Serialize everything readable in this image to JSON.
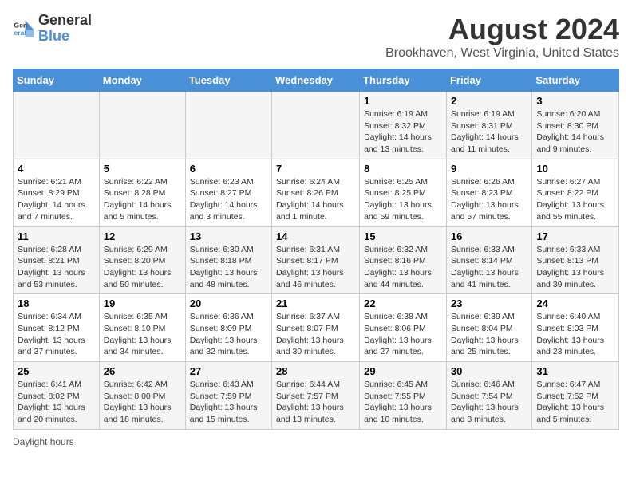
{
  "header": {
    "logo_line1": "General",
    "logo_line2": "Blue",
    "main_title": "August 2024",
    "subtitle": "Brookhaven, West Virginia, United States"
  },
  "days_of_week": [
    "Sunday",
    "Monday",
    "Tuesday",
    "Wednesday",
    "Thursday",
    "Friday",
    "Saturday"
  ],
  "footer": "Daylight hours",
  "weeks": [
    [
      {
        "num": "",
        "info": ""
      },
      {
        "num": "",
        "info": ""
      },
      {
        "num": "",
        "info": ""
      },
      {
        "num": "",
        "info": ""
      },
      {
        "num": "1",
        "info": "Sunrise: 6:19 AM\nSunset: 8:32 PM\nDaylight: 14 hours and 13 minutes."
      },
      {
        "num": "2",
        "info": "Sunrise: 6:19 AM\nSunset: 8:31 PM\nDaylight: 14 hours and 11 minutes."
      },
      {
        "num": "3",
        "info": "Sunrise: 6:20 AM\nSunset: 8:30 PM\nDaylight: 14 hours and 9 minutes."
      }
    ],
    [
      {
        "num": "4",
        "info": "Sunrise: 6:21 AM\nSunset: 8:29 PM\nDaylight: 14 hours and 7 minutes."
      },
      {
        "num": "5",
        "info": "Sunrise: 6:22 AM\nSunset: 8:28 PM\nDaylight: 14 hours and 5 minutes."
      },
      {
        "num": "6",
        "info": "Sunrise: 6:23 AM\nSunset: 8:27 PM\nDaylight: 14 hours and 3 minutes."
      },
      {
        "num": "7",
        "info": "Sunrise: 6:24 AM\nSunset: 8:26 PM\nDaylight: 14 hours and 1 minute."
      },
      {
        "num": "8",
        "info": "Sunrise: 6:25 AM\nSunset: 8:25 PM\nDaylight: 13 hours and 59 minutes."
      },
      {
        "num": "9",
        "info": "Sunrise: 6:26 AM\nSunset: 8:23 PM\nDaylight: 13 hours and 57 minutes."
      },
      {
        "num": "10",
        "info": "Sunrise: 6:27 AM\nSunset: 8:22 PM\nDaylight: 13 hours and 55 minutes."
      }
    ],
    [
      {
        "num": "11",
        "info": "Sunrise: 6:28 AM\nSunset: 8:21 PM\nDaylight: 13 hours and 53 minutes."
      },
      {
        "num": "12",
        "info": "Sunrise: 6:29 AM\nSunset: 8:20 PM\nDaylight: 13 hours and 50 minutes."
      },
      {
        "num": "13",
        "info": "Sunrise: 6:30 AM\nSunset: 8:18 PM\nDaylight: 13 hours and 48 minutes."
      },
      {
        "num": "14",
        "info": "Sunrise: 6:31 AM\nSunset: 8:17 PM\nDaylight: 13 hours and 46 minutes."
      },
      {
        "num": "15",
        "info": "Sunrise: 6:32 AM\nSunset: 8:16 PM\nDaylight: 13 hours and 44 minutes."
      },
      {
        "num": "16",
        "info": "Sunrise: 6:33 AM\nSunset: 8:14 PM\nDaylight: 13 hours and 41 minutes."
      },
      {
        "num": "17",
        "info": "Sunrise: 6:33 AM\nSunset: 8:13 PM\nDaylight: 13 hours and 39 minutes."
      }
    ],
    [
      {
        "num": "18",
        "info": "Sunrise: 6:34 AM\nSunset: 8:12 PM\nDaylight: 13 hours and 37 minutes."
      },
      {
        "num": "19",
        "info": "Sunrise: 6:35 AM\nSunset: 8:10 PM\nDaylight: 13 hours and 34 minutes."
      },
      {
        "num": "20",
        "info": "Sunrise: 6:36 AM\nSunset: 8:09 PM\nDaylight: 13 hours and 32 minutes."
      },
      {
        "num": "21",
        "info": "Sunrise: 6:37 AM\nSunset: 8:07 PM\nDaylight: 13 hours and 30 minutes."
      },
      {
        "num": "22",
        "info": "Sunrise: 6:38 AM\nSunset: 8:06 PM\nDaylight: 13 hours and 27 minutes."
      },
      {
        "num": "23",
        "info": "Sunrise: 6:39 AM\nSunset: 8:04 PM\nDaylight: 13 hours and 25 minutes."
      },
      {
        "num": "24",
        "info": "Sunrise: 6:40 AM\nSunset: 8:03 PM\nDaylight: 13 hours and 23 minutes."
      }
    ],
    [
      {
        "num": "25",
        "info": "Sunrise: 6:41 AM\nSunset: 8:02 PM\nDaylight: 13 hours and 20 minutes."
      },
      {
        "num": "26",
        "info": "Sunrise: 6:42 AM\nSunset: 8:00 PM\nDaylight: 13 hours and 18 minutes."
      },
      {
        "num": "27",
        "info": "Sunrise: 6:43 AM\nSunset: 7:59 PM\nDaylight: 13 hours and 15 minutes."
      },
      {
        "num": "28",
        "info": "Sunrise: 6:44 AM\nSunset: 7:57 PM\nDaylight: 13 hours and 13 minutes."
      },
      {
        "num": "29",
        "info": "Sunrise: 6:45 AM\nSunset: 7:55 PM\nDaylight: 13 hours and 10 minutes."
      },
      {
        "num": "30",
        "info": "Sunrise: 6:46 AM\nSunset: 7:54 PM\nDaylight: 13 hours and 8 minutes."
      },
      {
        "num": "31",
        "info": "Sunrise: 6:47 AM\nSunset: 7:52 PM\nDaylight: 13 hours and 5 minutes."
      }
    ]
  ]
}
